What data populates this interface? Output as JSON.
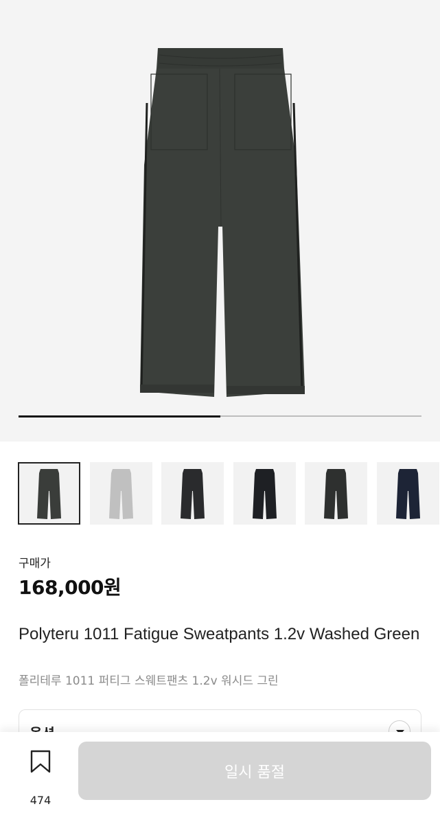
{
  "product_image": {
    "name": "pants-main-image",
    "carousel_progress": 0.5
  },
  "thumbnails": [
    {
      "color": "#3a3d3a",
      "selected": true
    },
    {
      "color": "#c0c0c0",
      "selected": false
    },
    {
      "color": "#2a2b2d",
      "selected": false
    },
    {
      "color": "#1e2024",
      "selected": false
    },
    {
      "color": "#2e302f",
      "selected": false
    },
    {
      "color": "#1d2436",
      "selected": false
    }
  ],
  "price_section": {
    "label": "구매가",
    "price": "168,000원"
  },
  "product": {
    "title_en": "Polyteru 1011 Fatigue Sweatpants 1.2v Washed Green",
    "title_ko": "폴리테루 1011 퍼티그 스웨트팬츠 1.2v 워시드 그린"
  },
  "option": {
    "label": "옵션"
  },
  "bottom_bar": {
    "bookmark_count": "474",
    "buy_button_label": "일시 품절"
  },
  "colors": {
    "accent": "#111111",
    "disabled_button": "#d5d5d5",
    "main_pants": "#3b3f3b"
  },
  "icons": [
    "bookmark-icon",
    "chevron-down-icon"
  ]
}
